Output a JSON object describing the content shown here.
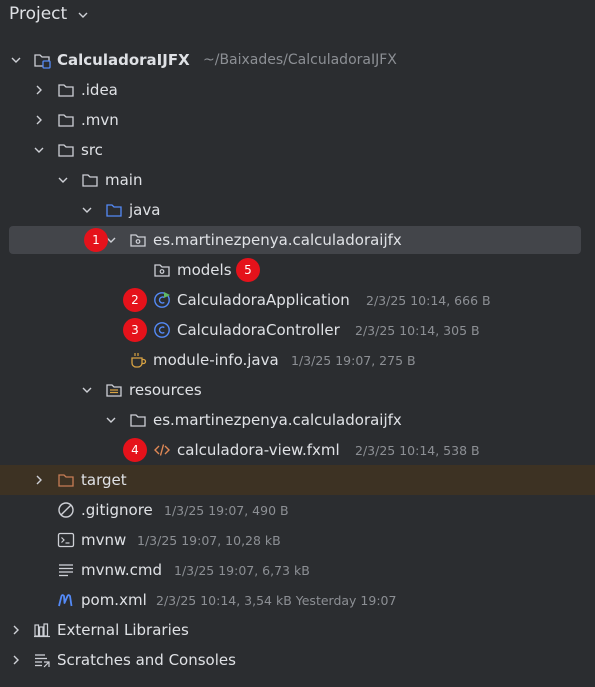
{
  "header": {
    "title": "Project",
    "dropdown_icon": "chevron-down-icon"
  },
  "tree": {
    "root": {
      "name": "CalculadoraIJFX",
      "path": "~/Baixades/CalculadoraIJFX"
    },
    "idea": {
      "name": ".idea"
    },
    "mvn": {
      "name": ".mvn"
    },
    "src": {
      "name": "src"
    },
    "main": {
      "name": "main"
    },
    "java": {
      "name": "java"
    },
    "pkg_java": {
      "name": "es.martinezpenya.calculadoraijfx"
    },
    "models": {
      "name": "models"
    },
    "app": {
      "name": "CalculadoraApplication",
      "meta": "2/3/25 10:14, 666 B"
    },
    "controller": {
      "name": "CalculadoraController",
      "meta": "2/3/25 10:14, 305 B"
    },
    "module_info": {
      "name": "module-info.java",
      "meta": "1/3/25 19:07, 275 B"
    },
    "resources": {
      "name": "resources"
    },
    "pkg_res": {
      "name": "es.martinezpenya.calculadoraijfx"
    },
    "fxml": {
      "name": "calculadora-view.fxml",
      "meta": "2/3/25 10:14, 538 B"
    },
    "target": {
      "name": "target"
    },
    "gitignore": {
      "name": ".gitignore",
      "meta": "1/3/25 19:07, 490 B"
    },
    "mvnw": {
      "name": "mvnw",
      "meta": "1/3/25 19:07, 10,28 kB"
    },
    "mvnw_cmd": {
      "name": "mvnw.cmd",
      "meta": "1/3/25 19:07, 6,73 kB"
    },
    "pom": {
      "name": "pom.xml",
      "meta": "2/3/25 10:14, 3,54 kB Yesterday 19:07"
    },
    "external_libs": {
      "name": "External Libraries"
    },
    "scratches": {
      "name": "Scratches and Consoles"
    }
  },
  "badges": [
    "1",
    "2",
    "3",
    "4",
    "5"
  ],
  "colors": {
    "background": "#2b2d30",
    "selection": "#43454a",
    "excluded_row": "#3d3223",
    "badge": "#e5121b",
    "java_folder": "#548af7",
    "class_icon": "#548af7",
    "app_icon_accent": "#5fb865",
    "target_folder": "#c77d55",
    "module_icon": "#d9a343",
    "fxml_icon": "#e08855",
    "maven_icon": "#548af7"
  }
}
